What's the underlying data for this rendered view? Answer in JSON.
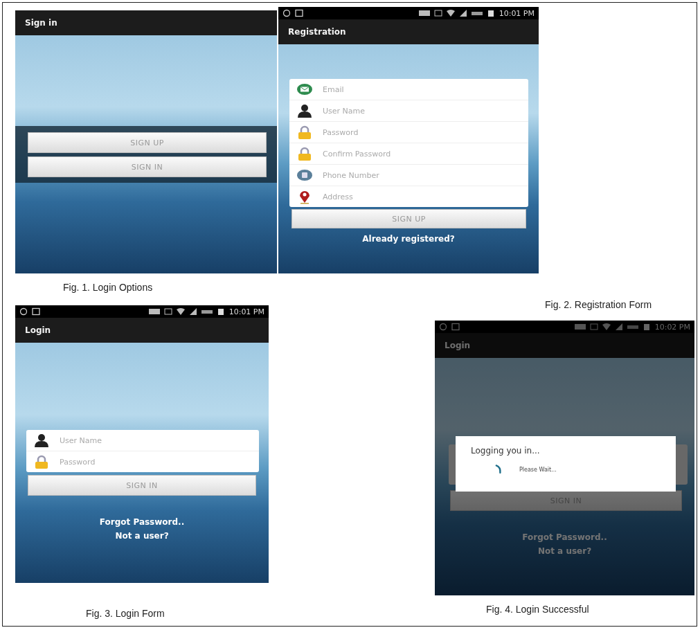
{
  "figures": [
    {
      "kind": "options",
      "caption": "Fig. 1. Login Options",
      "screen": {
        "title": "Sign in",
        "buttons": [
          "SIGN UP",
          "SIGN IN"
        ]
      }
    },
    {
      "kind": "register",
      "caption": "Fig. 2. Registration Form",
      "screen": {
        "status_time": "10:01 PM",
        "title": "Registration",
        "fields": [
          {
            "kind": "email",
            "placeholder": "Email"
          },
          {
            "kind": "user",
            "placeholder": "User Name"
          },
          {
            "kind": "lock",
            "placeholder": "Password"
          },
          {
            "kind": "lock",
            "placeholder": "Confirm Password"
          },
          {
            "kind": "phone",
            "placeholder": "Phone Number"
          },
          {
            "kind": "pin",
            "placeholder": "Address"
          }
        ],
        "button": "SIGN UP",
        "links": [
          "Already registered?"
        ]
      }
    },
    {
      "kind": "login",
      "caption": "Fig. 3. Login Form",
      "screen": {
        "status_time": "10:01 PM",
        "title": "Login",
        "fields": [
          {
            "kind": "user",
            "placeholder": "User Name"
          },
          {
            "kind": "lock",
            "placeholder": "Password"
          }
        ],
        "button": "SIGN IN",
        "links": [
          "Forgot Password..",
          "Not a user?"
        ]
      }
    },
    {
      "kind": "progress",
      "caption": "Fig. 4. Login Successful",
      "screen": {
        "status_time": "10:02 PM",
        "title": "Login",
        "button": "SIGN IN",
        "links": [
          "Forgot Password..",
          "Not a user?"
        ],
        "dialog": {
          "title": "Logging you in...",
          "message": "Please Wait..."
        }
      }
    }
  ]
}
